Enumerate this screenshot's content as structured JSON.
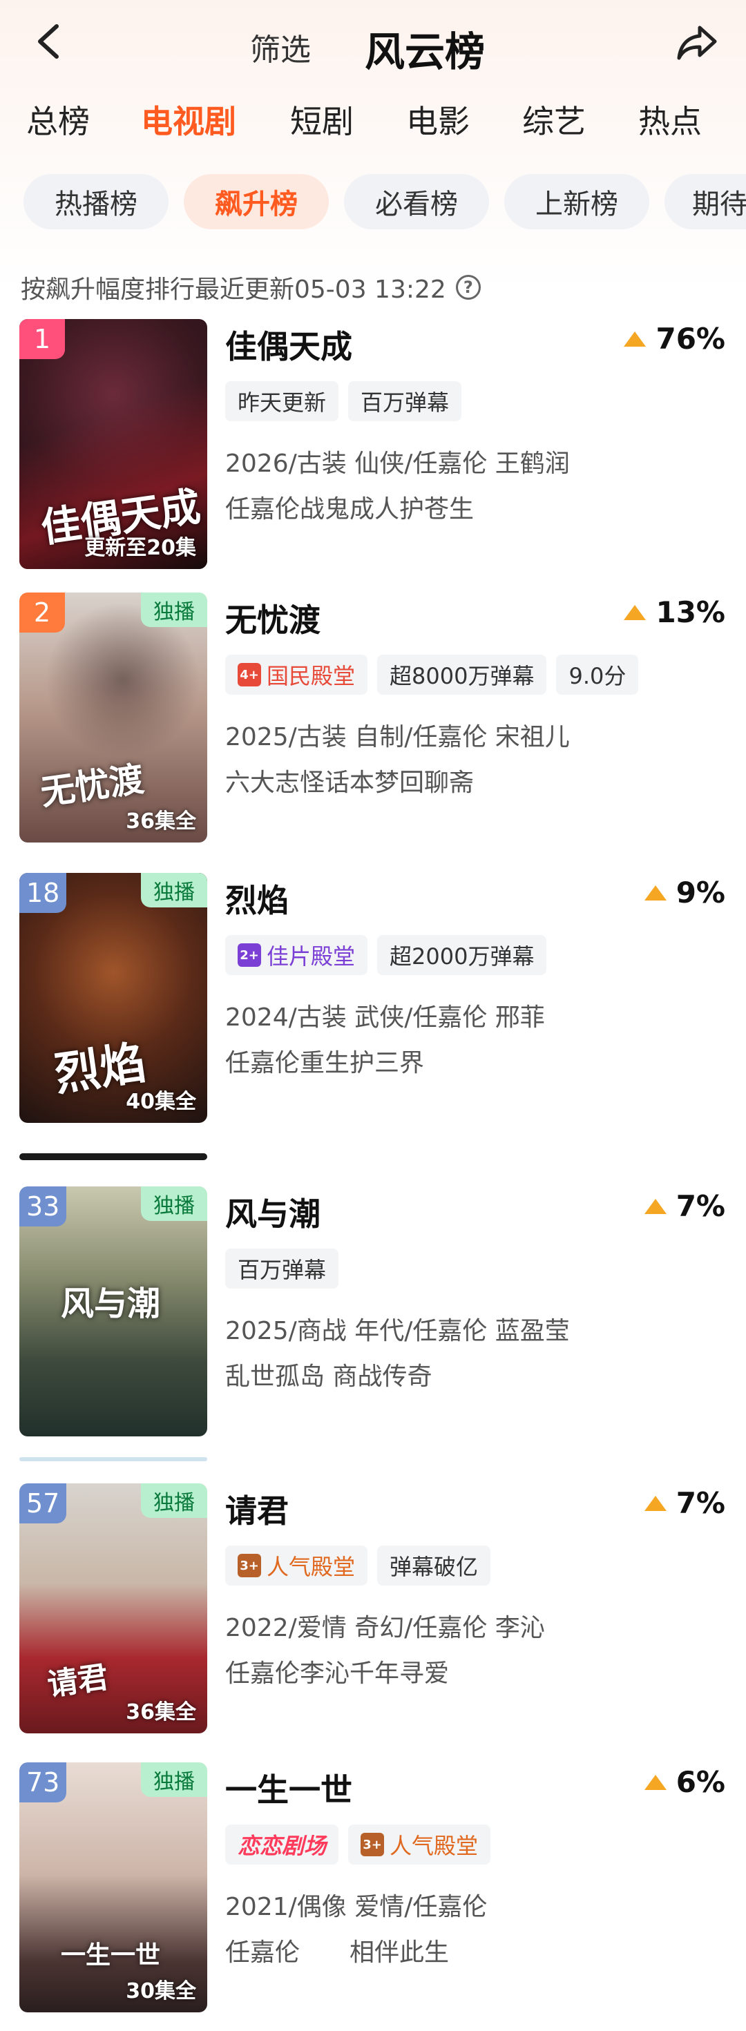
{
  "header": {
    "filter_label": "筛选",
    "title": "风云榜"
  },
  "category_tabs": [
    "总榜",
    "电视剧",
    "短剧",
    "电影",
    "综艺",
    "热点"
  ],
  "sub_tabs": [
    "热播榜",
    "飙升榜",
    "必看榜",
    "上新榜",
    "期待"
  ],
  "update_note": "按飙升幅度排行最近更新05-03 13:22",
  "info_icon_glyph": "?",
  "colors": {
    "accent": "#ff5a1f",
    "trend_up": "#f5a623",
    "rank_pink": "#ff4f7b",
    "rank_orange": "#ff7a3d",
    "rank_blue": "#6f8fcf",
    "exclusive_bg": "#b8f0cf"
  },
  "items": [
    {
      "rank": "1",
      "title": "佳偶天成",
      "trend": "76%",
      "exclusive": "",
      "episodes": "更新至20集",
      "poster_title": "佳偶天成",
      "tags": [
        "昨天更新",
        "百万弹幕"
      ],
      "meta": "2026/古装 仙侠/任嘉伦 王鹤润",
      "desc": "任嘉伦战鬼成人护苍生"
    },
    {
      "rank": "2",
      "title": "无忧渡",
      "trend": "13%",
      "exclusive": "独播",
      "episodes": "36集全",
      "poster_title": "无忧渡",
      "tags": [
        "国民殿堂",
        "超8000万弹幕",
        "9.0分"
      ],
      "hall_badge": "4+",
      "meta": "2025/古装 自制/任嘉伦 宋祖儿",
      "desc": "六大志怪话本梦回聊斋"
    },
    {
      "rank": "18",
      "title": "烈焰",
      "trend": "9%",
      "exclusive": "独播",
      "episodes": "40集全",
      "poster_title": "烈焰",
      "tags": [
        "佳片殿堂",
        "超2000万弹幕"
      ],
      "hall_badge": "2+",
      "meta": "2024/古装 武侠/任嘉伦 邢菲",
      "desc": "任嘉伦重生护三界"
    },
    {
      "rank": "33",
      "title": "风与潮",
      "trend": "7%",
      "exclusive": "独播",
      "episodes": "",
      "poster_title": "风与潮",
      "tags": [
        "百万弹幕"
      ],
      "meta": "2025/商战 年代/任嘉伦 蓝盈莹",
      "desc": "乱世孤岛 商战传奇"
    },
    {
      "rank": "57",
      "title": "请君",
      "trend": "7%",
      "exclusive": "独播",
      "episodes": "36集全",
      "poster_title": "请君",
      "tags": [
        "人气殿堂",
        "弹幕破亿"
      ],
      "hall_badge": "3+",
      "meta": "2022/爱情 奇幻/任嘉伦 李沁",
      "desc": "任嘉伦李沁千年寻爱"
    },
    {
      "rank": "73",
      "title": "一生一世",
      "trend": "6%",
      "exclusive": "独播",
      "episodes": "30集全",
      "poster_title": "一生一世",
      "tags": [
        "恋恋剧场",
        "人气殿堂"
      ],
      "hall_badge": "3+",
      "meta": "2021/偶像 爱情/任嘉伦",
      "desc": "任嘉伦　　相伴此生"
    }
  ]
}
